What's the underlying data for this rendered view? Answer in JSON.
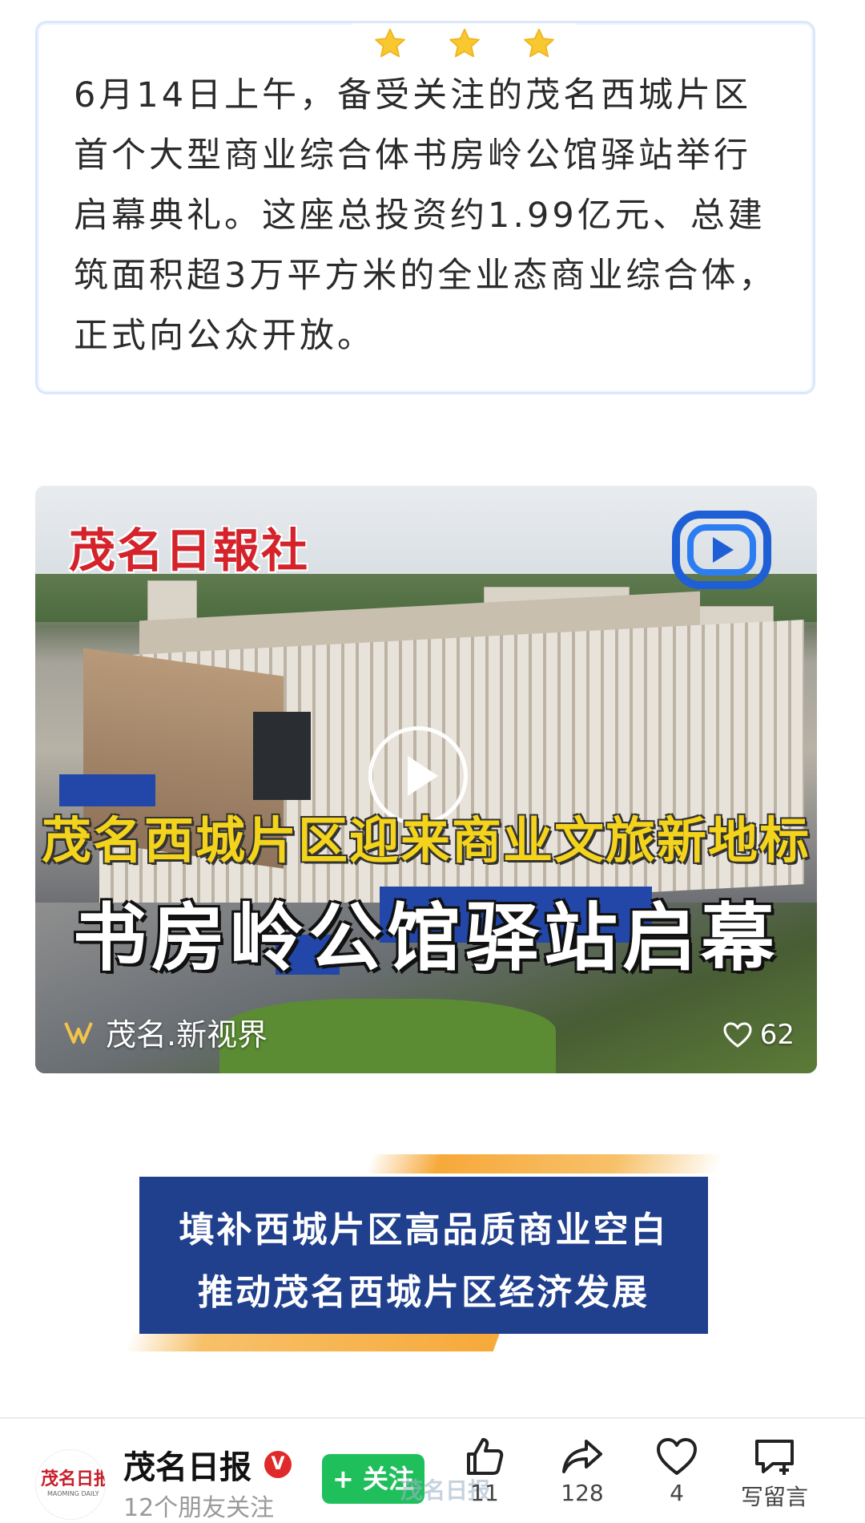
{
  "intro": {
    "text": "6月14日上午，备受关注的茂名西城片区首个大型商业综合体书房岭公馆驿站举行启幕典礼。这座总投资约1.99亿元、总建筑面积超3万平方米的全业态商业综合体，正式向公众开放。"
  },
  "colors": {
    "accent_blue": "#20408e",
    "star_yellow": "#f7c82f",
    "follow_green": "#1fbf5c",
    "logo_red": "#d4232b",
    "accent_orange": "#f7a93a"
  },
  "video": {
    "logo_text": "茂名日報社",
    "headline_1": "茂名西城片区迎来商业文旅新地标",
    "headline_2": "书房岭公馆驿站启幕",
    "channel_name": "茂名.新视界",
    "likes": "62",
    "play_icon": "play-icon",
    "like_icon": "heart-outline-icon"
  },
  "banner": {
    "line1": "填补西城片区高品质商业空白",
    "line2": "推动茂名西城片区经济发展"
  },
  "bottom_bar": {
    "avatar_text": "茂名日报",
    "avatar_sub": "MAOMING DAILY",
    "account_name": "茂名日报",
    "verified_mark": "V",
    "account_sub": "12个朋友关注",
    "follow_label": "+ 关注",
    "watermark": "茂名日报",
    "actions": [
      {
        "icon": "thumbs-up-icon",
        "count": "11"
      },
      {
        "icon": "share-icon",
        "count": "128"
      },
      {
        "icon": "heart-icon",
        "count": "4"
      },
      {
        "icon": "comment-icon",
        "count": "写留言"
      }
    ]
  }
}
